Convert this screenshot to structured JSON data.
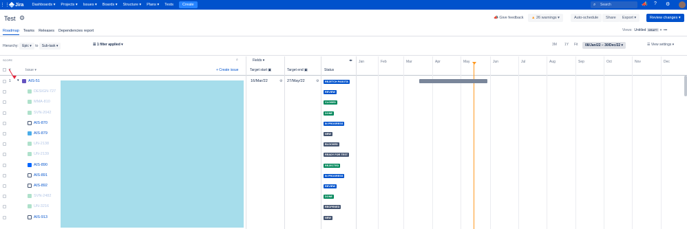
{
  "topnav": {
    "brand": "Jira",
    "items": [
      "Dashboards ▾",
      "Projects ▾",
      "Issues ▾",
      "Boards ▾",
      "Structure ▾",
      "Plans ▾",
      "Tests"
    ],
    "create": "Create",
    "search_placeholder": "Search"
  },
  "header": {
    "title": "Test",
    "give_feedback": "Give feedback",
    "warnings": "26 warnings",
    "auto_schedule": "Auto-schedule",
    "share": "Share",
    "export": "Export",
    "review_changes": "Review changes"
  },
  "tabs": [
    "Roadmap",
    "Teams",
    "Releases",
    "Dependencies report"
  ],
  "views": {
    "label": "Views:",
    "name": "Untitled",
    "badge": "DRAFT"
  },
  "filters": {
    "hierarchy_label": "Hierarchy:",
    "from": "Epic",
    "to_label": "to",
    "to": "Sub-task",
    "filter_applied": "1 filter applied",
    "ranges": [
      "3M",
      "1Y",
      "Fit"
    ],
    "date_range": "08/Jan/22 – 30/Dec/22",
    "view_settings": "View settings"
  },
  "columns": {
    "scope": "SCOPE",
    "num": "#",
    "issue": "Issue",
    "create_issue": "+ Create issue",
    "fields": "Fields",
    "target_start": "Target start",
    "target_end": "Target end",
    "status": "Status"
  },
  "months": [
    "Jan",
    "Feb",
    "Mar",
    "Apr",
    "May",
    "Jun",
    "Jul",
    "Aug",
    "Sep",
    "Oct",
    "Nov",
    "Dec"
  ],
  "colors": {
    "blue": "#0052CC",
    "green": "#00875A",
    "dark": "#42526E",
    "bar": "#7A869A",
    "today": "#FF991F"
  },
  "rows": [
    {
      "num": "1",
      "key": "AIS-51",
      "type": "epic",
      "faded": false,
      "start": "16/Mar/22",
      "end": "27/May/22",
      "status": "REJETCH PASOTA",
      "status_color": "#0052CC"
    },
    {
      "num": "",
      "key": "DESIGN-727",
      "type": "story",
      "faded": true,
      "start": "",
      "end": "",
      "status": "REVIEW",
      "status_color": "#0052CC"
    },
    {
      "num": "",
      "key": "MMA-810",
      "type": "story",
      "faded": true,
      "start": "",
      "end": "",
      "status": "CLOSED",
      "status_color": "#00875A"
    },
    {
      "num": "",
      "key": "SVN-2042",
      "type": "story",
      "faded": true,
      "start": "",
      "end": "",
      "status": "DONE",
      "status_color": "#00875A"
    },
    {
      "num": "",
      "key": "AIS-870",
      "type": "task",
      "faded": false,
      "start": "",
      "end": "",
      "status": "IN PROGRESS",
      "status_color": "#0052CC"
    },
    {
      "num": "",
      "key": "AIS-879",
      "type": "subtask",
      "faded": false,
      "start": "",
      "end": "",
      "status": "NEW",
      "status_color": "#42526E"
    },
    {
      "num": "",
      "key": "UN-2138",
      "type": "story",
      "faded": true,
      "start": "",
      "end": "",
      "status": "BLOCKED",
      "status_color": "#42526E"
    },
    {
      "num": "",
      "key": "UN-2139",
      "type": "story",
      "faded": true,
      "start": "",
      "end": "",
      "status": "READY FOR TEST",
      "status_color": "#42526E"
    },
    {
      "num": "",
      "key": "AIS-890",
      "type": "check",
      "faded": false,
      "start": "",
      "end": "",
      "status": "REJECTED",
      "status_color": "#00875A"
    },
    {
      "num": "",
      "key": "AIS-891",
      "type": "task",
      "faded": false,
      "start": "",
      "end": "",
      "status": "IN PROGRESS",
      "status_color": "#0052CC"
    },
    {
      "num": "",
      "key": "AIS-892",
      "type": "task",
      "faded": false,
      "start": "",
      "end": "",
      "status": "REVIEW",
      "status_color": "#0052CC"
    },
    {
      "num": "",
      "key": "SVN-2482",
      "type": "story",
      "faded": true,
      "start": "",
      "end": "",
      "status": "DONE",
      "status_color": "#00875A"
    },
    {
      "num": "",
      "key": "UN-3216",
      "type": "story",
      "faded": true,
      "start": "",
      "end": "",
      "status": "REOPENED",
      "status_color": "#42526E"
    },
    {
      "num": "",
      "key": "AIS-913",
      "type": "task",
      "faded": false,
      "start": "",
      "end": "",
      "status": "NEW",
      "status_color": "#42526E"
    }
  ]
}
